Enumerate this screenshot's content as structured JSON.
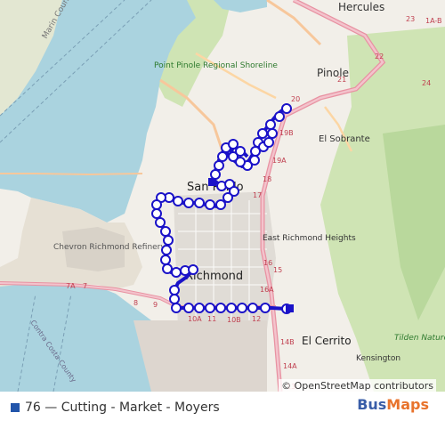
{
  "map": {
    "places": {
      "hercules": "Hercules",
      "pinole": "Pinole",
      "el_sobrante": "El Sobrante",
      "san_pablo": "San Pablo",
      "richmond": "Richmond",
      "east_richmond_heights": "East Richmond Heights",
      "el_cerrito": "El Cerrito",
      "kensington": "Kensington",
      "chevron_refinery": "Chevron Richmond Refinery",
      "point_pinole": "Point Pinole Regional Shoreline",
      "tilden": "Tilden Nature Area",
      "marin_county": "Marin County",
      "contra_costa": "Contra Costa County"
    },
    "exits": [
      "23",
      "1A-B",
      "22",
      "21",
      "20",
      "19B",
      "19A",
      "18",
      "17",
      "16",
      "16A",
      "15",
      "14B",
      "14A",
      "13",
      "12",
      "11",
      "10B",
      "10A",
      "9",
      "8",
      "7A",
      "7",
      "24"
    ],
    "route_color": "#1a12c8",
    "attribution": "© OpenStreetMap contributors"
  },
  "footer": {
    "route_label": "76 — Cutting - Market - Moyers",
    "brand_part1": "Bus",
    "brand_part2": "Maps",
    "route_square_color": "#2255aa"
  }
}
